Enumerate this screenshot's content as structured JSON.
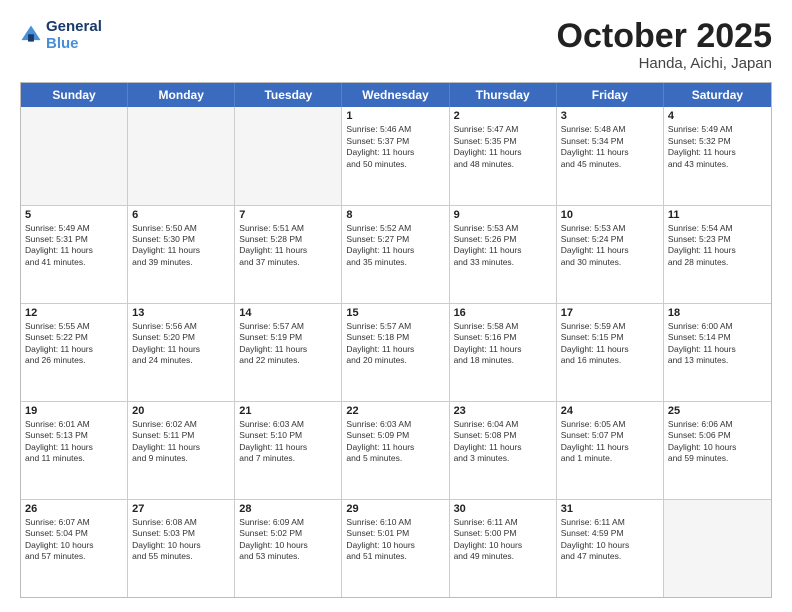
{
  "logo": {
    "line1": "General",
    "line2": "Blue"
  },
  "header": {
    "month": "October 2025",
    "location": "Handa, Aichi, Japan"
  },
  "weekdays": [
    "Sunday",
    "Monday",
    "Tuesday",
    "Wednesday",
    "Thursday",
    "Friday",
    "Saturday"
  ],
  "rows": [
    [
      {
        "day": "",
        "info": "",
        "empty": true
      },
      {
        "day": "",
        "info": "",
        "empty": true
      },
      {
        "day": "",
        "info": "",
        "empty": true
      },
      {
        "day": "1",
        "info": "Sunrise: 5:46 AM\nSunset: 5:37 PM\nDaylight: 11 hours\nand 50 minutes."
      },
      {
        "day": "2",
        "info": "Sunrise: 5:47 AM\nSunset: 5:35 PM\nDaylight: 11 hours\nand 48 minutes."
      },
      {
        "day": "3",
        "info": "Sunrise: 5:48 AM\nSunset: 5:34 PM\nDaylight: 11 hours\nand 45 minutes."
      },
      {
        "day": "4",
        "info": "Sunrise: 5:49 AM\nSunset: 5:32 PM\nDaylight: 11 hours\nand 43 minutes."
      }
    ],
    [
      {
        "day": "5",
        "info": "Sunrise: 5:49 AM\nSunset: 5:31 PM\nDaylight: 11 hours\nand 41 minutes."
      },
      {
        "day": "6",
        "info": "Sunrise: 5:50 AM\nSunset: 5:30 PM\nDaylight: 11 hours\nand 39 minutes."
      },
      {
        "day": "7",
        "info": "Sunrise: 5:51 AM\nSunset: 5:28 PM\nDaylight: 11 hours\nand 37 minutes."
      },
      {
        "day": "8",
        "info": "Sunrise: 5:52 AM\nSunset: 5:27 PM\nDaylight: 11 hours\nand 35 minutes."
      },
      {
        "day": "9",
        "info": "Sunrise: 5:53 AM\nSunset: 5:26 PM\nDaylight: 11 hours\nand 33 minutes."
      },
      {
        "day": "10",
        "info": "Sunrise: 5:53 AM\nSunset: 5:24 PM\nDaylight: 11 hours\nand 30 minutes."
      },
      {
        "day": "11",
        "info": "Sunrise: 5:54 AM\nSunset: 5:23 PM\nDaylight: 11 hours\nand 28 minutes."
      }
    ],
    [
      {
        "day": "12",
        "info": "Sunrise: 5:55 AM\nSunset: 5:22 PM\nDaylight: 11 hours\nand 26 minutes."
      },
      {
        "day": "13",
        "info": "Sunrise: 5:56 AM\nSunset: 5:20 PM\nDaylight: 11 hours\nand 24 minutes."
      },
      {
        "day": "14",
        "info": "Sunrise: 5:57 AM\nSunset: 5:19 PM\nDaylight: 11 hours\nand 22 minutes."
      },
      {
        "day": "15",
        "info": "Sunrise: 5:57 AM\nSunset: 5:18 PM\nDaylight: 11 hours\nand 20 minutes."
      },
      {
        "day": "16",
        "info": "Sunrise: 5:58 AM\nSunset: 5:16 PM\nDaylight: 11 hours\nand 18 minutes."
      },
      {
        "day": "17",
        "info": "Sunrise: 5:59 AM\nSunset: 5:15 PM\nDaylight: 11 hours\nand 16 minutes."
      },
      {
        "day": "18",
        "info": "Sunrise: 6:00 AM\nSunset: 5:14 PM\nDaylight: 11 hours\nand 13 minutes."
      }
    ],
    [
      {
        "day": "19",
        "info": "Sunrise: 6:01 AM\nSunset: 5:13 PM\nDaylight: 11 hours\nand 11 minutes."
      },
      {
        "day": "20",
        "info": "Sunrise: 6:02 AM\nSunset: 5:11 PM\nDaylight: 11 hours\nand 9 minutes."
      },
      {
        "day": "21",
        "info": "Sunrise: 6:03 AM\nSunset: 5:10 PM\nDaylight: 11 hours\nand 7 minutes."
      },
      {
        "day": "22",
        "info": "Sunrise: 6:03 AM\nSunset: 5:09 PM\nDaylight: 11 hours\nand 5 minutes."
      },
      {
        "day": "23",
        "info": "Sunrise: 6:04 AM\nSunset: 5:08 PM\nDaylight: 11 hours\nand 3 minutes."
      },
      {
        "day": "24",
        "info": "Sunrise: 6:05 AM\nSunset: 5:07 PM\nDaylight: 11 hours\nand 1 minute."
      },
      {
        "day": "25",
        "info": "Sunrise: 6:06 AM\nSunset: 5:06 PM\nDaylight: 10 hours\nand 59 minutes."
      }
    ],
    [
      {
        "day": "26",
        "info": "Sunrise: 6:07 AM\nSunset: 5:04 PM\nDaylight: 10 hours\nand 57 minutes."
      },
      {
        "day": "27",
        "info": "Sunrise: 6:08 AM\nSunset: 5:03 PM\nDaylight: 10 hours\nand 55 minutes."
      },
      {
        "day": "28",
        "info": "Sunrise: 6:09 AM\nSunset: 5:02 PM\nDaylight: 10 hours\nand 53 minutes."
      },
      {
        "day": "29",
        "info": "Sunrise: 6:10 AM\nSunset: 5:01 PM\nDaylight: 10 hours\nand 51 minutes."
      },
      {
        "day": "30",
        "info": "Sunrise: 6:11 AM\nSunset: 5:00 PM\nDaylight: 10 hours\nand 49 minutes."
      },
      {
        "day": "31",
        "info": "Sunrise: 6:11 AM\nSunset: 4:59 PM\nDaylight: 10 hours\nand 47 minutes."
      },
      {
        "day": "",
        "info": "",
        "empty": true
      }
    ]
  ]
}
